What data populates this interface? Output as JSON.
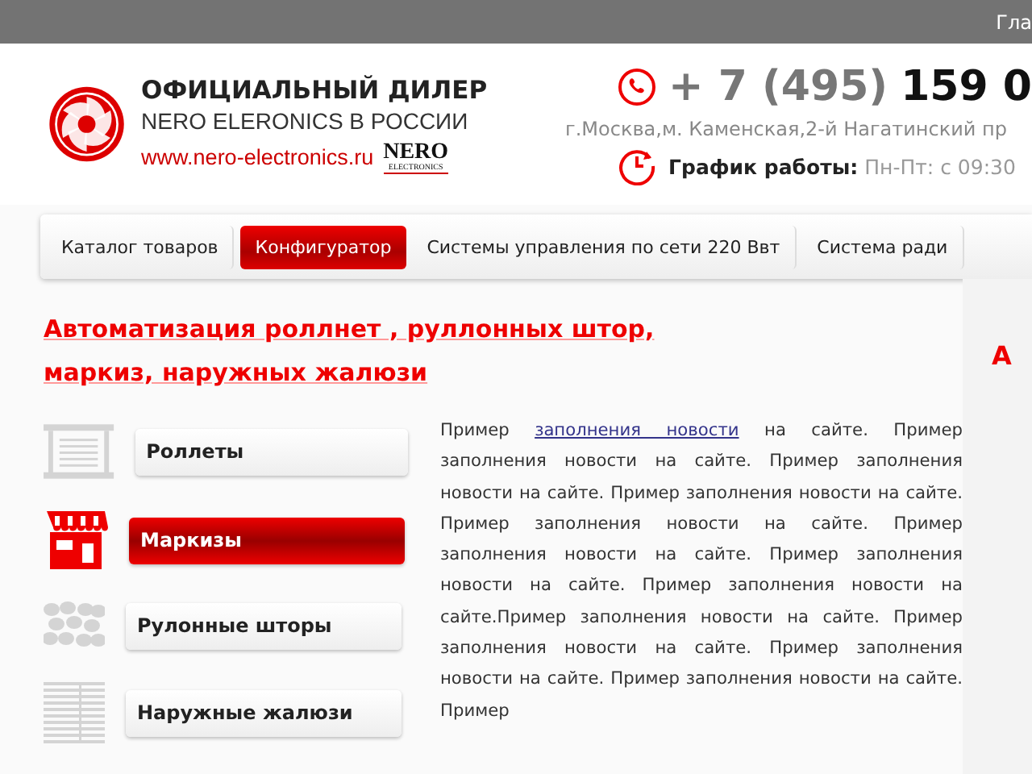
{
  "top_bar": {
    "link": "Гла"
  },
  "header": {
    "dealer_title": "ОФИЦИАЛЬНЫЙ ДИЛЕР",
    "dealer_subtitle": "NERO ELERONICS В РОССИИ",
    "website": "www.nero-electronics.ru",
    "brand": "NERO",
    "brand_sub": "ELECTRONICS",
    "phone_code": "+ 7 (495)",
    "phone_number": "159 0",
    "address": "г.Москва,м. Каменская,2-й Нагатинский пр",
    "hours_label": "График работы:",
    "hours": "Пн-Пт: с 09:30"
  },
  "nav": [
    {
      "label": "Каталог товаров",
      "selected": false
    },
    {
      "label": "Конфигуратор",
      "selected": true
    },
    {
      "label": "Системы управления по сети 220 Ввт",
      "selected": false
    },
    {
      "label": "Система ради",
      "selected": false
    }
  ],
  "heading": "Автоматизация роллнет , руллонных штор, маркиз, наружных жалюзи",
  "categories": [
    {
      "kind": "roller",
      "label": "Роллеты",
      "selected": false
    },
    {
      "kind": "awning",
      "label": "Маркизы",
      "selected": true
    },
    {
      "kind": "blind",
      "label": "Рулонные шторы",
      "selected": false
    },
    {
      "kind": "jalousie",
      "label": "Наружные жалюзи",
      "selected": false
    }
  ],
  "article": {
    "text_before": "Пример",
    "link": "заполнения новости",
    "text_after": "на сайте. Пример заполнения новости на сайте. Пример заполнения новости на сайте. Пример заполнения новости на сайте. Пример заполнения новости на сайте. Пример заполнения новости на сайте. Пример заполнения новости на сайте. Пример заполнения новости на сайте.Пример заполнения новости на сайте. Пример заполнения новости на сайте. Пример заполнения новости на сайте. Пример заполнения новости на сайте. Пример"
  },
  "side_heading": "А"
}
